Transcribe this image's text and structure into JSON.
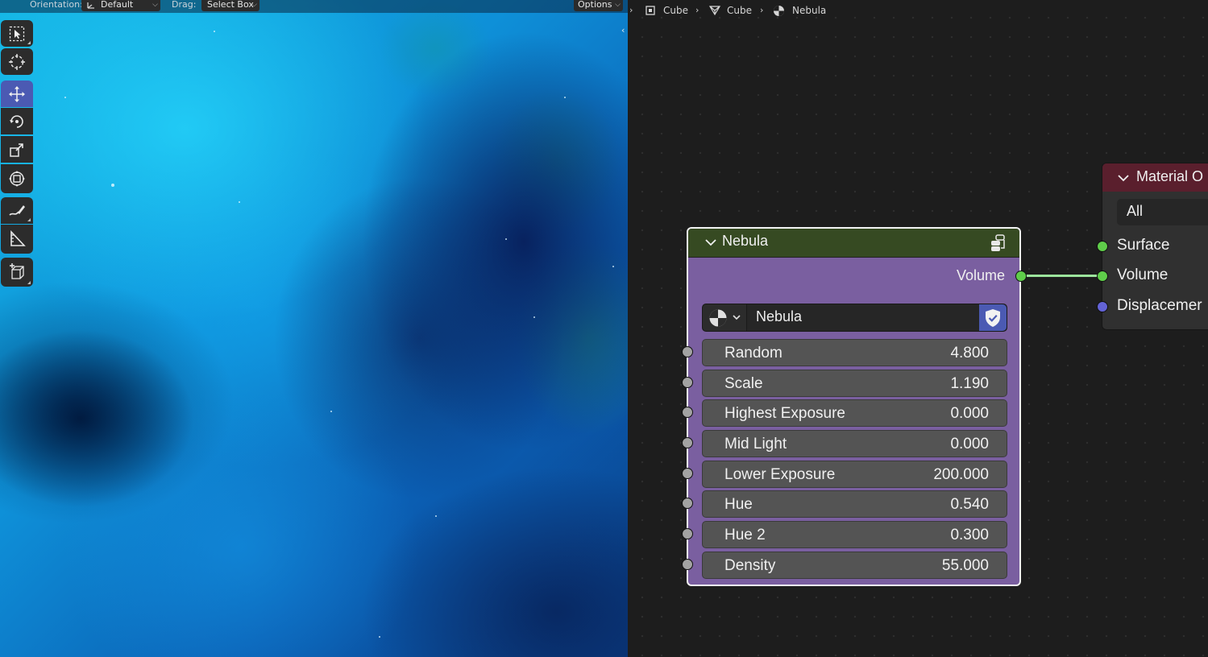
{
  "viewport_header": {
    "orientation_label": "Orientation:",
    "orientation_value": "Default",
    "drag_label": "Drag:",
    "drag_value": "Select Box",
    "options_label": "Options"
  },
  "toolbar": {
    "tools": [
      {
        "name": "select-box",
        "icon": "select-box-icon",
        "active": false
      },
      {
        "name": "cursor",
        "icon": "cursor-icon",
        "active": false
      },
      {
        "name": "move",
        "icon": "move-icon",
        "active": true
      },
      {
        "name": "rotate",
        "icon": "rotate-icon",
        "active": false
      },
      {
        "name": "scale",
        "icon": "scale-icon",
        "active": false
      },
      {
        "name": "transform",
        "icon": "transform-icon",
        "active": false
      },
      {
        "name": "annotate",
        "icon": "annotate-icon",
        "active": false
      },
      {
        "name": "measure",
        "icon": "measure-icon",
        "active": false
      },
      {
        "name": "add-cube",
        "icon": "add-cube-icon",
        "active": false
      }
    ]
  },
  "breadcrumb": {
    "items": [
      {
        "label": "Cube",
        "icon": "object-icon"
      },
      {
        "label": "Cube",
        "icon": "mesh-icon"
      },
      {
        "label": "Nebula",
        "icon": "material-icon"
      }
    ]
  },
  "nebula_node": {
    "title": "Nebula",
    "output_label": "Volume",
    "datablock_name": "Nebula",
    "header_color": "#364a22",
    "body_color": "#7a5fa0",
    "fields": [
      {
        "label": "Random",
        "value": "4.800"
      },
      {
        "label": "Scale",
        "value": "1.190"
      },
      {
        "label": "Highest Exposure",
        "value": "0.000"
      },
      {
        "label": "Mid Light",
        "value": "0.000"
      },
      {
        "label": "Lower Exposure",
        "value": "200.000"
      },
      {
        "label": "Hue",
        "value": "0.540"
      },
      {
        "label": "Hue 2",
        "value": "0.300"
      },
      {
        "label": "Density",
        "value": "55.000"
      }
    ]
  },
  "material_output_node": {
    "title": "Material O",
    "target": "All",
    "header_color": "#5a1f2d",
    "inputs": [
      {
        "label": "Surface",
        "socket": "green"
      },
      {
        "label": "Volume",
        "socket": "green"
      },
      {
        "label": "Displacemer",
        "socket": "blue"
      }
    ]
  },
  "colors": {
    "socket_shader": "#5fcd4a",
    "socket_float": "#a3a3a3",
    "socket_vector": "#6363d6",
    "active_tool": "#4b5ab3",
    "wire": "#9ce49c"
  }
}
